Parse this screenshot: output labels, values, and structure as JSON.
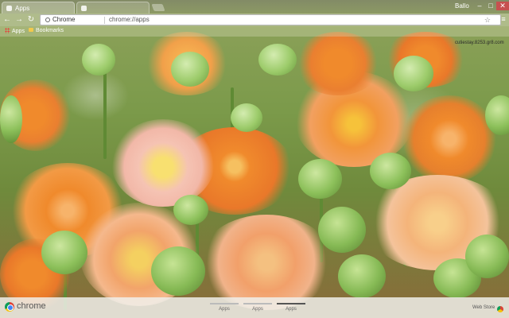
{
  "browser": {
    "tabs": [
      {
        "label": "Apps",
        "active": true
      },
      {
        "label": "",
        "active": false
      }
    ],
    "profile_name": "Ballo",
    "window_controls": {
      "minimize": "–",
      "maximize": "□",
      "close": "✕"
    }
  },
  "toolbar": {
    "back": "←",
    "forward": "→",
    "reload": "↻",
    "chip_label": "Chrome",
    "url": "chrome://apps",
    "star": "☆",
    "menu": "≡"
  },
  "bookmarks": {
    "apps_label": "Apps",
    "folder_label": "Bookmarks"
  },
  "watermark": "cutiestay.8253.gr8.com",
  "ntp": {
    "brand": "chrome",
    "page_tabs": [
      {
        "label": "Apps",
        "active": false
      },
      {
        "label": "Apps",
        "active": false
      },
      {
        "label": "Apps",
        "active": true
      }
    ],
    "webstore_label": "Web Store"
  },
  "colors": {
    "petal_orange": "#f08a2c",
    "petal_light": "#f7b36a",
    "bud_green": "#8cc05a",
    "stem_green": "#5f8a34",
    "close_red": "#c75050"
  }
}
